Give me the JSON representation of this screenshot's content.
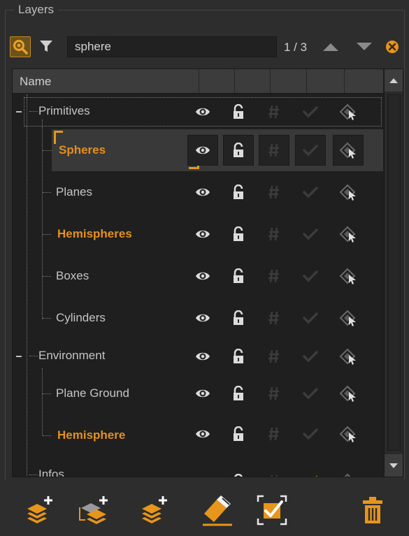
{
  "panel": {
    "title": "Layers"
  },
  "search": {
    "value": "sphere",
    "match_count": "1 / 3",
    "search_mode_icon": "search-mode-icon",
    "filter_icon": "filter-icon"
  },
  "table": {
    "column_name": "Name",
    "rows": [
      {
        "label": "Primitives",
        "level": 0,
        "highlight": false,
        "selected": false
      },
      {
        "label": "Spheres",
        "level": 1,
        "highlight": true,
        "selected": true
      },
      {
        "label": "Planes",
        "level": 1,
        "highlight": false,
        "selected": false
      },
      {
        "label": "Hemispheres",
        "level": 1,
        "highlight": true,
        "selected": false
      },
      {
        "label": "Boxes",
        "level": 1,
        "highlight": false,
        "selected": false
      },
      {
        "label": "Cylinders",
        "level": 1,
        "highlight": false,
        "selected": false
      },
      {
        "label": "Environment",
        "level": 0,
        "highlight": false,
        "selected": false
      },
      {
        "label": "Plane Ground",
        "level": 1,
        "highlight": false,
        "selected": false
      },
      {
        "label": "Hemisphere",
        "level": 1,
        "highlight": true,
        "selected": false
      },
      {
        "label": "Infos",
        "level": 0,
        "highlight": false,
        "selected": false
      }
    ]
  },
  "colors": {
    "accent": "#e3901e",
    "background": "#2d2d2d",
    "tree_bg": "#1f1f1f"
  },
  "toolbar": {
    "buttons": [
      "add-layer-icon",
      "add-sublayer-icon",
      "add-layer-selection-icon",
      "clear-eraser-icon",
      "select-all-icon",
      "delete-icon"
    ]
  }
}
